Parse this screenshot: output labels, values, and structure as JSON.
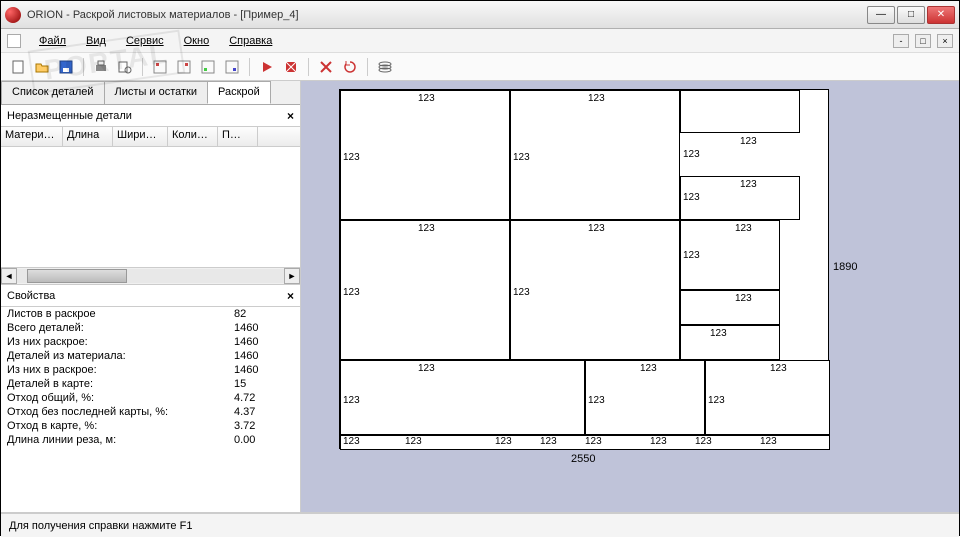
{
  "window": {
    "title": "ORION - Раскрой листовых материалов - [Пример_4]"
  },
  "menu": {
    "file": "Файл",
    "view": "Вид",
    "service": "Сервис",
    "window": "Окно",
    "help": "Справка"
  },
  "tabs": {
    "parts_list": "Список деталей",
    "sheets": "Листы и остатки",
    "cutting": "Раскрой"
  },
  "unplaced": {
    "title": "Неразмещенные детали",
    "cols": {
      "material": "Матери…",
      "length": "Длина",
      "width": "Шири…",
      "qty": "Коли…",
      "p": "П…"
    }
  },
  "props": {
    "title": "Свойства",
    "rows": [
      {
        "k": "Листов в раскрое",
        "v": "82"
      },
      {
        "k": "Всего деталей:",
        "v": "1460"
      },
      {
        "k": "Из них раскрое:",
        "v": "1460"
      },
      {
        "k": "Деталей из материала:",
        "v": "1460"
      },
      {
        "k": "Из них в раскрое:",
        "v": "1460"
      },
      {
        "k": "Деталей в карте:",
        "v": "15"
      },
      {
        "k": "Отход общий, %:",
        "v": "4.72"
      },
      {
        "k": "Отход без последней карты, %:",
        "v": "4.37"
      },
      {
        "k": "Отход в карте, %:",
        "v": "3.72"
      },
      {
        "k": "Длина линии реза, м:",
        "v": "0.00"
      }
    ]
  },
  "sheet": {
    "width_label": "2550",
    "height_label": "1890",
    "piece_label": "123"
  },
  "status": {
    "text": "Для получения справки нажмите F1"
  },
  "watermark": "PORTAL"
}
